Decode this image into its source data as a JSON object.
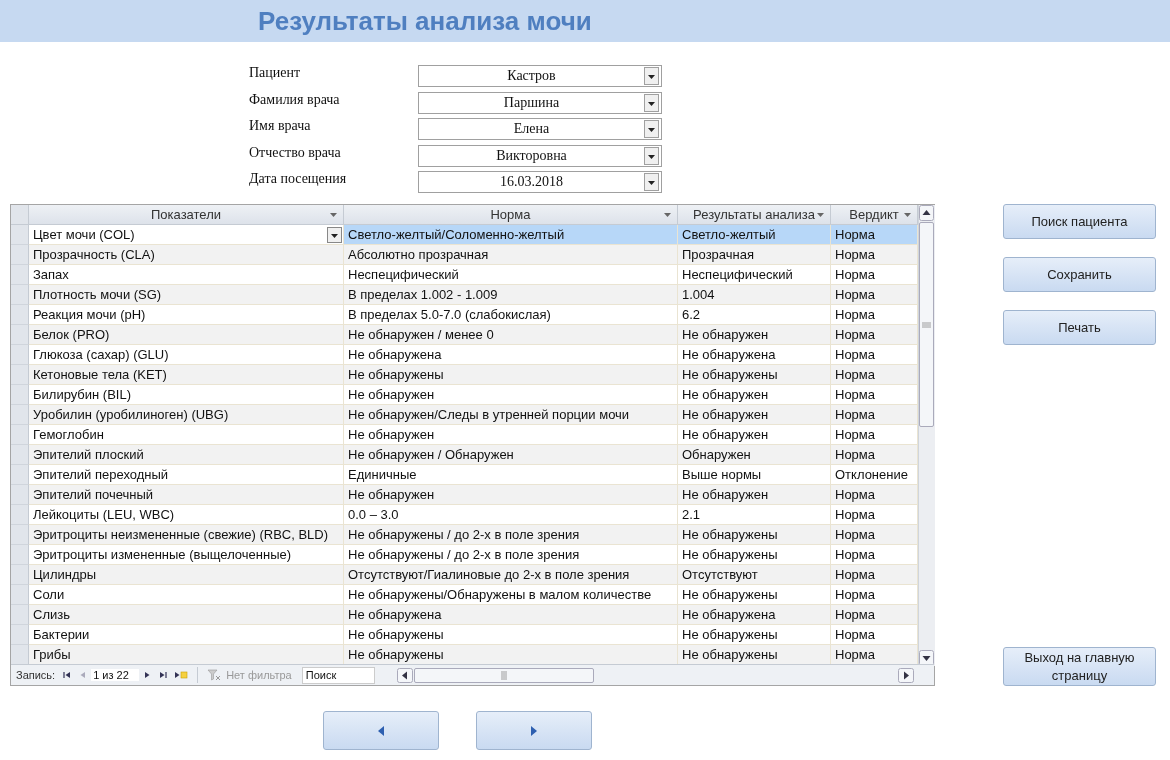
{
  "title": "Результаты анализа мочи",
  "form": [
    {
      "label": "Пациент",
      "value": "Кастров"
    },
    {
      "label": "Фамилия врача",
      "value": "Паршина"
    },
    {
      "label": "Имя врача",
      "value": "Елена"
    },
    {
      "label": "Отчество врача",
      "value": "Викторовна"
    },
    {
      "label": "Дата посещения",
      "value": "16.03.2018"
    }
  ],
  "grid": {
    "columns": [
      "Показатели",
      "Норма",
      "Результаты анализа",
      "Вердикт"
    ],
    "rows": [
      {
        "name": "Цвет мочи (COL)",
        "norm": "Светло-желтый/Соломенно-желтый",
        "result": "Светло-желтый",
        "verdict": "Норма",
        "selected": true
      },
      {
        "name": "Прозрачность (CLA)",
        "norm": "Абсолютно прозрачная",
        "result": "Прозрачная",
        "verdict": "Норма",
        "selected": false
      },
      {
        "name": "Запах",
        "norm": "Неспецифический",
        "result": "Неспецифический",
        "verdict": "Норма",
        "selected": false
      },
      {
        "name": "Плотность мочи (SG)",
        "norm": "В пределах 1.002 - 1.009",
        "result": "1.004",
        "verdict": "Норма",
        "selected": false
      },
      {
        "name": "Реакция мочи (pH)",
        "norm": "В пределах 5.0-7.0 (слабокислая)",
        "result": "6.2",
        "verdict": "Норма",
        "selected": false
      },
      {
        "name": "Белок (PRO)",
        "norm": "Не обнаружен / менее 0",
        "result": "Не обнаружен",
        "verdict": "Норма",
        "selected": false
      },
      {
        "name": "Глюкоза (сахар) (GLU)",
        "norm": "Не обнаружена",
        "result": "Не обнаружена",
        "verdict": "Норма",
        "selected": false
      },
      {
        "name": "Кетоновые тела (KET)",
        "norm": "Не обнаружены",
        "result": "Не обнаружены",
        "verdict": "Норма",
        "selected": false
      },
      {
        "name": "Билирубин (BIL)",
        "norm": "Не обнаружен",
        "result": "Не обнаружен",
        "verdict": "Норма",
        "selected": false
      },
      {
        "name": "Уробилин (уробилиноген) (UBG)",
        "norm": "Не обнаружен/Следы в утренней порции мочи",
        "result": "Не обнаружен",
        "verdict": "Норма",
        "selected": false
      },
      {
        "name": "Гемоглобин",
        "norm": "Не обнаружен",
        "result": "Не обнаружен",
        "verdict": "Норма",
        "selected": false
      },
      {
        "name": "Эпителий плоский",
        "norm": "Не обнаружен / Обнаружен",
        "result": "Обнаружен",
        "verdict": "Норма",
        "selected": false
      },
      {
        "name": "Эпителий переходный",
        "norm": "Единичные",
        "result": "Выше нормы",
        "verdict": "Отклонение",
        "selected": false
      },
      {
        "name": "Эпителий почечный",
        "norm": "Не обнаружен",
        "result": "Не обнаружен",
        "verdict": "Норма",
        "selected": false
      },
      {
        "name": "Лейкоциты (LEU, WBC)",
        "norm": "0.0 – 3.0",
        "result": "2.1",
        "verdict": "Норма",
        "selected": false
      },
      {
        "name": "Эритроциты неизмененные (свежие) (RBC, BLD)",
        "norm": "Не обнаружены / до 2-х в поле зрения",
        "result": "Не обнаружены",
        "verdict": "Норма",
        "selected": false
      },
      {
        "name": "Эритроциты измененные (выщелоченные)",
        "norm": "Не обнаружены / до 2-х в поле зрения",
        "result": "Не обнаружены",
        "verdict": "Норма",
        "selected": false
      },
      {
        "name": "Цилиндры",
        "norm": "Отсутствуют/Гиалиновые до 2-х в поле зрения",
        "result": "Отсутствуют",
        "verdict": "Норма",
        "selected": false
      },
      {
        "name": "Соли",
        "norm": "Не обнаружены/Обнаружены в малом количестве",
        "result": "Не обнаружены",
        "verdict": "Норма",
        "selected": false
      },
      {
        "name": "Слизь",
        "norm": "Не обнаружена",
        "result": "Не обнаружена",
        "verdict": "Норма",
        "selected": false
      },
      {
        "name": "Бактерии",
        "norm": "Не обнаружены",
        "result": "Не обнаружены",
        "verdict": "Норма",
        "selected": false
      },
      {
        "name": "Грибы",
        "norm": "Не обнаружены",
        "result": "Не обнаружены",
        "verdict": "Норма",
        "selected": false
      }
    ]
  },
  "navigator": {
    "label": "Запись:",
    "record": "1 из 22",
    "filter": "Нет фильтра",
    "search": "Поиск"
  },
  "buttons": [
    "Поиск пациента",
    "Сохранить",
    "Печать"
  ],
  "exit_button": "Выход на главную страницу"
}
